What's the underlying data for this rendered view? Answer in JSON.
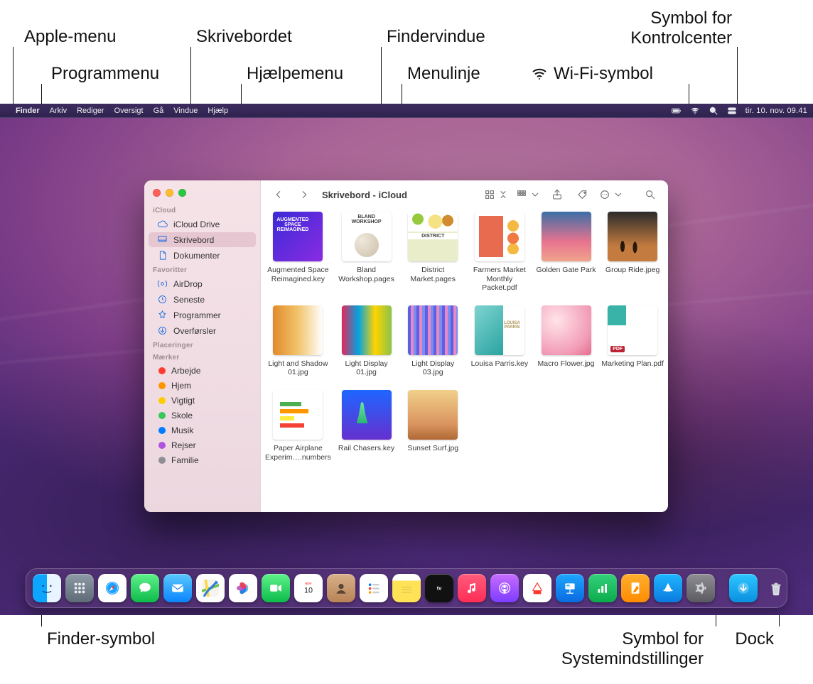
{
  "callouts": {
    "apple_menu": "Apple-menu",
    "programmenu": "Programmenu",
    "skrivebordet": "Skrivebordet",
    "help_menu": "Hjælpemenu",
    "finder_window": "Findervindue",
    "menubar": "Menulinje",
    "wifi_symbol": "Wi-Fi-symbol",
    "control_center_a": "Symbol for",
    "control_center_b": "Kontrolcenter",
    "finder_icon": "Finder-symbol",
    "syspref_a": "Symbol for",
    "syspref_b": "Systemindstillinger",
    "dock": "Dock"
  },
  "menubar": {
    "items": [
      "Finder",
      "Arkiv",
      "Rediger",
      "Oversigt",
      "Gå",
      "Vindue",
      "Hjælp"
    ],
    "datetime": "tir. 10. nov.  09.41"
  },
  "finder": {
    "title": "Skrivebord - iCloud",
    "sidebar": {
      "groups": [
        {
          "label": "iCloud",
          "items": [
            {
              "icon": "cloud",
              "label": "iCloud Drive",
              "sel": false
            },
            {
              "icon": "desktop",
              "label": "Skrivebord",
              "sel": true
            },
            {
              "icon": "doc",
              "label": "Dokumenter",
              "sel": false
            }
          ]
        },
        {
          "label": "Favoritter",
          "items": [
            {
              "icon": "airdrop",
              "label": "AirDrop"
            },
            {
              "icon": "clock",
              "label": "Seneste"
            },
            {
              "icon": "apps",
              "label": "Programmer"
            },
            {
              "icon": "download",
              "label": "Overførsler"
            }
          ]
        },
        {
          "label": "Placeringer",
          "items": []
        },
        {
          "label": "Mærker",
          "items": [
            {
              "tag": "#ff3b30",
              "label": "Arbejde"
            },
            {
              "tag": "#ff9500",
              "label": "Hjem"
            },
            {
              "tag": "#ffcc00",
              "label": "Vigtigt"
            },
            {
              "tag": "#34c759",
              "label": "Skole"
            },
            {
              "tag": "#007aff",
              "label": "Musik"
            },
            {
              "tag": "#af52de",
              "label": "Rejser"
            },
            {
              "tag": "#8e8e93",
              "label": "Familie"
            }
          ]
        }
      ]
    },
    "files": [
      {
        "cls": "g-a",
        "name": "Augmented Space Reimagined.key"
      },
      {
        "cls": "g-b",
        "name": "Bland Workshop.pages"
      },
      {
        "cls": "g-c",
        "name": "District Market.pages"
      },
      {
        "cls": "g-d",
        "name": "Farmers Market Monthly Packet.pdf"
      },
      {
        "cls": "g-e",
        "name": "Golden Gate Park"
      },
      {
        "cls": "g-f",
        "name": "Group Ride.jpeg"
      },
      {
        "cls": "g-g",
        "name": "Light and Shadow 01.jpg"
      },
      {
        "cls": "g-h",
        "name": "Light Display 01.jpg"
      },
      {
        "cls": "g-i",
        "name": "Light Display 03.jpg"
      },
      {
        "cls": "g-j",
        "name": "Louisa Parris.key"
      },
      {
        "cls": "g-k",
        "name": "Macro Flower.jpg"
      },
      {
        "cls": "g-l",
        "name": "Marketing Plan.pdf"
      },
      {
        "cls": "g-m",
        "name": "Paper Airplane Experim….numbers"
      },
      {
        "cls": "g-n",
        "name": "Rail Chasers.key"
      },
      {
        "cls": "g-o",
        "name": "Sunset Surf.jpg"
      }
    ]
  },
  "dock": {
    "apps": [
      {
        "cls": "a-finder",
        "name": "finder"
      },
      {
        "cls": "a-launch",
        "name": "launchpad"
      },
      {
        "cls": "a-safari",
        "name": "safari"
      },
      {
        "cls": "a-msg",
        "name": "messages"
      },
      {
        "cls": "a-mail",
        "name": "mail"
      },
      {
        "cls": "a-maps",
        "name": "maps"
      },
      {
        "cls": "a-photos",
        "name": "photos"
      },
      {
        "cls": "a-ft",
        "name": "facetime"
      },
      {
        "cls": "a-cal",
        "name": "calendar"
      },
      {
        "cls": "a-contacts",
        "name": "contacts"
      },
      {
        "cls": "a-rem",
        "name": "reminders"
      },
      {
        "cls": "a-notes",
        "name": "notes"
      },
      {
        "cls": "a-tv",
        "name": "tv"
      },
      {
        "cls": "a-music",
        "name": "music"
      },
      {
        "cls": "a-pod",
        "name": "podcasts"
      },
      {
        "cls": "a-news",
        "name": "news"
      },
      {
        "cls": "a-key",
        "name": "keynote"
      },
      {
        "cls": "a-num",
        "name": "numbers"
      },
      {
        "cls": "a-pages",
        "name": "pages"
      },
      {
        "cls": "a-store",
        "name": "appstore"
      },
      {
        "cls": "a-pref",
        "name": "system-preferences"
      }
    ],
    "right": [
      {
        "cls": "a-dl",
        "name": "downloads"
      },
      {
        "cls": "a-trash",
        "name": "trash"
      }
    ],
    "calendar": {
      "month": "NOV",
      "day": "10"
    }
  }
}
